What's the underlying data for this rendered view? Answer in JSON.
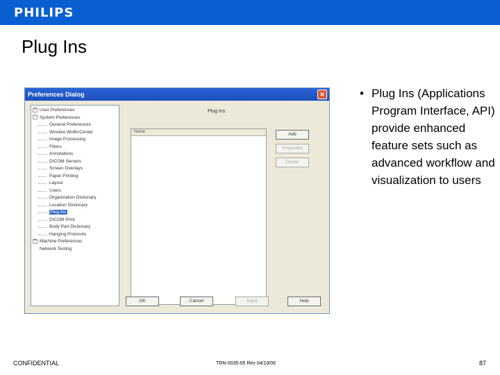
{
  "brand": {
    "logo": "PHILIPS",
    "bar_color": "#0a5fd3"
  },
  "slide": {
    "title": "Plug Ins"
  },
  "dialog": {
    "title": "Preferences Dialog",
    "close_glyph": "✕",
    "tree": [
      {
        "label": "User Preferences",
        "exp": "+",
        "level": 0
      },
      {
        "label": "System Preferences",
        "exp": "−",
        "level": 0
      },
      {
        "label": "General Preferences",
        "level": 1
      },
      {
        "label": "Window Width/Center",
        "level": 1
      },
      {
        "label": "Image Processing",
        "level": 1
      },
      {
        "label": "Filters",
        "level": 1
      },
      {
        "label": "Annotations",
        "level": 1
      },
      {
        "label": "DICOM Servers",
        "level": 1
      },
      {
        "label": "Screen Overlays",
        "level": 1
      },
      {
        "label": "Paper Printing",
        "level": 1
      },
      {
        "label": "Layout",
        "level": 1
      },
      {
        "label": "Users",
        "level": 1
      },
      {
        "label": "Organization Dictionary",
        "level": 1
      },
      {
        "label": "Location Dictionary",
        "level": 1
      },
      {
        "label": "Plug Ins",
        "level": 1,
        "selected": true
      },
      {
        "label": "DICOM Print",
        "level": 1
      },
      {
        "label": "Body Part Dictionary",
        "level": 1
      },
      {
        "label": "Hanging Protocols",
        "level": 1
      },
      {
        "label": "Machine Preferences",
        "exp": "+",
        "level": 0
      },
      {
        "label": "Network Testing",
        "level": 0
      }
    ],
    "panel_heading": "Plug Ins",
    "list_header": "Name",
    "buttons": {
      "add": "Add",
      "properties": "Properties",
      "delete": "Delete"
    },
    "footer_buttons": {
      "ok": "OK",
      "cancel": "Cancel",
      "apply": "Apply",
      "help": "Help"
    }
  },
  "bullet": {
    "marker": "•",
    "text": "Plug Ins (Applications Program Interface, API) provide enhanced feature sets such as advanced workflow and visualization to users"
  },
  "footer": {
    "left": "CONFIDENTIAL",
    "center": "TRN-0035-05 Rev 04/19/06",
    "right": "87"
  }
}
